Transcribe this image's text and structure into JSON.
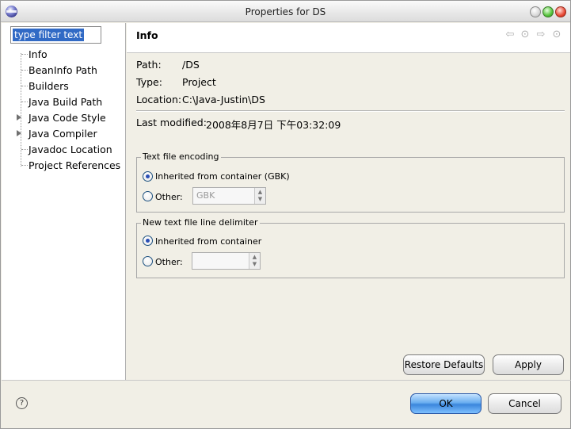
{
  "window": {
    "title": "Properties for DS"
  },
  "filter": {
    "placeholder": "type filter text"
  },
  "tree": [
    {
      "label": "Info"
    },
    {
      "label": "BeanInfo Path"
    },
    {
      "label": "Builders"
    },
    {
      "label": "Java Build Path"
    },
    {
      "label": "Java Code Style",
      "expandable": true
    },
    {
      "label": "Java Compiler",
      "expandable": true
    },
    {
      "label": "Javadoc Location"
    },
    {
      "label": "Project References"
    }
  ],
  "page": {
    "title": "Info",
    "nav_icons": [
      "back-arrow-icon",
      "dropdown-icon",
      "forward-arrow-icon",
      "dropdown-icon"
    ]
  },
  "info": {
    "path_label": "Path:",
    "path_value": "/DS",
    "type_label": "Type:",
    "type_value": "Project",
    "location_label": "Location:",
    "location_value": "C:\\Java-Justin\\DS",
    "modified_label": "Last modified:",
    "modified_value": "2008年8月7日 下午03:32:09"
  },
  "encoding": {
    "legend": "Text file encoding",
    "inherited_label": "Inherited from container (GBK)",
    "other_label": "Other:",
    "other_value": "GBK",
    "selected": "inherited"
  },
  "delimiter": {
    "legend": "New text file line delimiter",
    "inherited_label": "Inherited from container",
    "other_label": "Other:",
    "other_value": "",
    "selected": "inherited"
  },
  "buttons": {
    "restore": "Restore Defaults",
    "apply": "Apply",
    "ok": "OK",
    "cancel": "Cancel",
    "help": "?"
  }
}
